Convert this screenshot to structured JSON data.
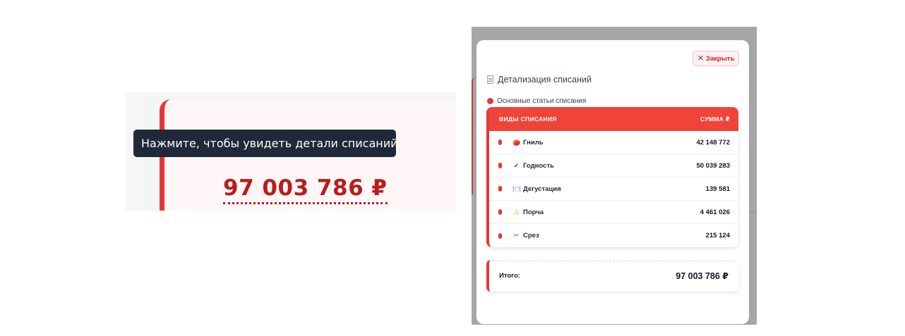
{
  "left": {
    "tooltip": "Нажмите, чтобы увидеть детали списаний",
    "amount": "97 003 786 ₽"
  },
  "modal": {
    "close_label": "Закрыть",
    "close_icon": "✕",
    "title": "Детализация списаний",
    "section_label": "Основные статьи списания",
    "columns": {
      "type": "ВИДЫ СПИСАНИЯ",
      "sum": "СУММА ₽"
    },
    "rows": [
      {
        "icon": "🍅",
        "name": "Гниль",
        "value": "42 148 772"
      },
      {
        "icon": "✔",
        "name": "Годность",
        "value": "50 039 283"
      },
      {
        "icon": "🍽",
        "name": "Дегустация",
        "value": "139 581"
      },
      {
        "icon": "⚠",
        "name": "Порча",
        "value": "4 461 026"
      },
      {
        "icon": "✂",
        "name": "Срез",
        "value": "215 124"
      }
    ],
    "total_label": "Итого:",
    "total_value": "97 003 786 ₽"
  },
  "colors": {
    "accent": "#e53935",
    "header": "#f04438",
    "amount": "#b91c1c",
    "tooltip_bg": "#1f2937"
  }
}
